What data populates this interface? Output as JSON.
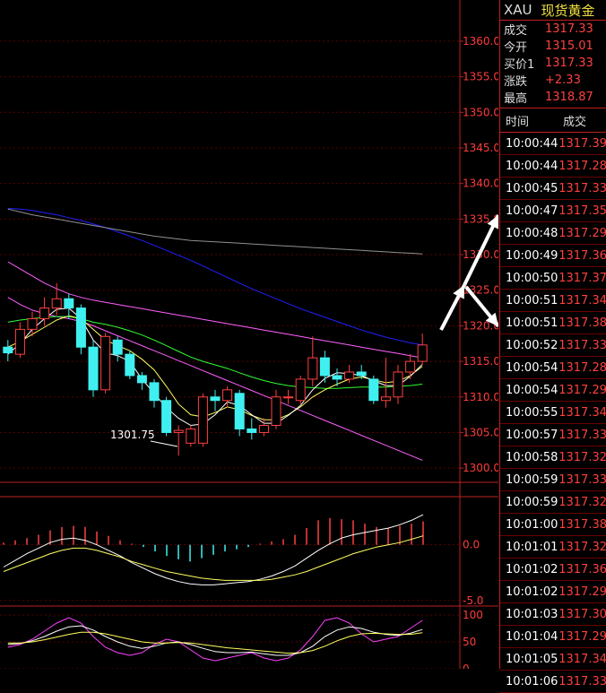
{
  "quote": {
    "symbol": "XAU",
    "name": "现货黄金",
    "rows": [
      {
        "label": "成交",
        "value": "1317.33"
      },
      {
        "label": "今开",
        "value": "1315.01"
      },
      {
        "label": "买价1",
        "value": "1317.33"
      },
      {
        "label": "涨跌",
        "value": "+2.33"
      },
      {
        "label": "最高",
        "value": "1318.87"
      }
    ]
  },
  "ticks": {
    "headers": {
      "time": "时间",
      "price": "成交"
    },
    "rows": [
      {
        "time": "10:00:44",
        "price": "1317.39"
      },
      {
        "time": "10:00:44",
        "price": "1317.28"
      },
      {
        "time": "10:00:45",
        "price": "1317.33"
      },
      {
        "time": "10:00:47",
        "price": "1317.35"
      },
      {
        "time": "10:00:48",
        "price": "1317.29"
      },
      {
        "time": "10:00:49",
        "price": "1317.36"
      },
      {
        "time": "10:00:50",
        "price": "1317.37"
      },
      {
        "time": "10:00:51",
        "price": "1317.34"
      },
      {
        "time": "10:00:51",
        "price": "1317.38"
      },
      {
        "time": "10:00:52",
        "price": "1317.33"
      },
      {
        "time": "10:00:54",
        "price": "1317.28"
      },
      {
        "time": "10:00:54",
        "price": "1317.29"
      },
      {
        "time": "10:00:55",
        "price": "1317.34"
      },
      {
        "time": "10:00:57",
        "price": "1317.33"
      },
      {
        "time": "10:00:58",
        "price": "1317.32"
      },
      {
        "time": "10:00:59",
        "price": "1317.33"
      },
      {
        "time": "10:00:59",
        "price": "1317.32"
      },
      {
        "time": "10:01:00",
        "price": "1317.38"
      },
      {
        "time": "10:01:01",
        "price": "1317.32"
      },
      {
        "time": "10:01:02",
        "price": "1317.36"
      },
      {
        "time": "10:01:02",
        "price": "1317.29"
      },
      {
        "time": "10:01:03",
        "price": "1317.30"
      },
      {
        "time": "10:01:04",
        "price": "1317.29"
      },
      {
        "time": "10:01:05",
        "price": "1317.34"
      },
      {
        "time": "10:01:06",
        "price": "1317.33"
      }
    ]
  },
  "chart_data": [
    {
      "type": "candlestick",
      "ylim": [
        1298,
        1361
      ],
      "y_ticks": [
        "1360.0",
        "1355.0",
        "1350.0",
        "1345.0",
        "1340.0",
        "1335.0",
        "1330.0",
        "1325.0",
        "1320.0",
        "1315.0",
        "1310.0",
        "1305.0",
        "1300.0"
      ],
      "y_tick_values": [
        1360,
        1355,
        1350,
        1345,
        1340,
        1335,
        1330,
        1325,
        1320,
        1315,
        1310,
        1305,
        1300
      ],
      "annotation": "1301.75",
      "candles": [
        {
          "o": 1317.0,
          "c": 1316.2,
          "h": 1318.0,
          "l": 1315.0
        },
        {
          "o": 1316.0,
          "c": 1319.5,
          "h": 1320.5,
          "l": 1315.5
        },
        {
          "o": 1319.5,
          "c": 1321.0,
          "h": 1322.0,
          "l": 1318.5
        },
        {
          "o": 1321.0,
          "c": 1322.5,
          "h": 1324.0,
          "l": 1320.0
        },
        {
          "o": 1322.5,
          "c": 1323.8,
          "h": 1326.0,
          "l": 1321.5
        },
        {
          "o": 1323.8,
          "c": 1322.5,
          "h": 1324.5,
          "l": 1321.0
        },
        {
          "o": 1322.5,
          "c": 1317.0,
          "h": 1323.0,
          "l": 1316.0
        },
        {
          "o": 1317.0,
          "c": 1311.0,
          "h": 1318.0,
          "l": 1310.0
        },
        {
          "o": 1311.0,
          "c": 1318.5,
          "h": 1319.0,
          "l": 1310.5
        },
        {
          "o": 1318.0,
          "c": 1316.0,
          "h": 1318.5,
          "l": 1315.0
        },
        {
          "o": 1316.0,
          "c": 1313.0,
          "h": 1316.5,
          "l": 1312.5
        },
        {
          "o": 1313.0,
          "c": 1312.0,
          "h": 1313.5,
          "l": 1311.0
        },
        {
          "o": 1312.0,
          "c": 1309.5,
          "h": 1312.5,
          "l": 1308.5
        },
        {
          "o": 1309.5,
          "c": 1305.0,
          "h": 1310.0,
          "l": 1304.5
        },
        {
          "o": 1305.0,
          "c": 1305.3,
          "h": 1306.0,
          "l": 1301.75
        },
        {
          "o": 1303.5,
          "c": 1305.5,
          "h": 1306.0,
          "l": 1303.0
        },
        {
          "o": 1303.5,
          "c": 1310.0,
          "h": 1310.5,
          "l": 1303.0
        },
        {
          "o": 1310.0,
          "c": 1309.5,
          "h": 1311.0,
          "l": 1308.0
        },
        {
          "o": 1309.5,
          "c": 1311.0,
          "h": 1311.5,
          "l": 1308.5
        },
        {
          "o": 1310.5,
          "c": 1305.5,
          "h": 1311.0,
          "l": 1304.5
        },
        {
          "o": 1305.5,
          "c": 1305.0,
          "h": 1307.0,
          "l": 1304.0
        },
        {
          "o": 1305.0,
          "c": 1306.0,
          "h": 1307.0,
          "l": 1304.5
        },
        {
          "o": 1306.0,
          "c": 1310.0,
          "h": 1311.0,
          "l": 1305.5
        },
        {
          "o": 1310.0,
          "c": 1310.0,
          "h": 1311.0,
          "l": 1309.0
        },
        {
          "o": 1309.5,
          "c": 1312.5,
          "h": 1313.0,
          "l": 1309.0
        },
        {
          "o": 1312.5,
          "c": 1315.5,
          "h": 1318.5,
          "l": 1311.5
        },
        {
          "o": 1315.5,
          "c": 1313.0,
          "h": 1316.5,
          "l": 1312.0
        },
        {
          "o": 1313.0,
          "c": 1312.5,
          "h": 1314.0,
          "l": 1311.5
        },
        {
          "o": 1312.5,
          "c": 1313.5,
          "h": 1314.5,
          "l": 1312.0
        },
        {
          "o": 1313.5,
          "c": 1313.0,
          "h": 1314.5,
          "l": 1312.5
        },
        {
          "o": 1312.5,
          "c": 1309.5,
          "h": 1313.0,
          "l": 1309.0
        },
        {
          "o": 1309.5,
          "c": 1310.0,
          "h": 1315.5,
          "l": 1308.5
        },
        {
          "o": 1310.0,
          "c": 1313.5,
          "h": 1314.5,
          "l": 1309.0
        },
        {
          "o": 1313.5,
          "c": 1315.0,
          "h": 1316.0,
          "l": 1312.5
        },
        {
          "o": 1315.0,
          "c": 1317.3,
          "h": 1318.9,
          "l": 1314.5
        }
      ],
      "lines": [
        {
          "color": "#2020ff",
          "values": [
            1336.5,
            1336.4,
            1336.2,
            1335.9,
            1335.6,
            1335.2,
            1334.8,
            1334.3,
            1333.8,
            1333.2,
            1332.6,
            1332.0,
            1331.3,
            1330.6,
            1329.9,
            1329.2,
            1328.4,
            1327.6,
            1326.8,
            1326.0,
            1325.2,
            1324.5,
            1323.8,
            1323.1,
            1322.4,
            1321.8,
            1321.2,
            1320.6,
            1320.0,
            1319.4,
            1318.9,
            1318.4,
            1318.0,
            1317.6,
            1317.3
          ]
        },
        {
          "color": "#909090",
          "values": [
            1336.4,
            1336.0,
            1335.6,
            1335.3,
            1335.0,
            1334.7,
            1334.4,
            1334.1,
            1333.8,
            1333.5,
            1333.2,
            1332.9,
            1332.6,
            1332.4,
            1332.2,
            1332.0,
            1331.9,
            1331.8,
            1331.7,
            1331.6,
            1331.5,
            1331.4,
            1331.3,
            1331.2,
            1331.1,
            1331.0,
            1330.9,
            1330.8,
            1330.7,
            1330.6,
            1330.5,
            1330.4,
            1330.3,
            1330.2,
            1330.1
          ]
        },
        {
          "color": "#ff60ff",
          "values": [
            1329.0,
            1328.0,
            1327.0,
            1326.0,
            1325.2,
            1324.5,
            1324.0,
            1323.6,
            1323.3,
            1323.0,
            1322.7,
            1322.4,
            1322.1,
            1321.8,
            1321.5,
            1321.2,
            1320.9,
            1320.6,
            1320.3,
            1320.0,
            1319.7,
            1319.4,
            1319.1,
            1318.8,
            1318.5,
            1318.2,
            1317.9,
            1317.6,
            1317.3,
            1317.0,
            1316.7,
            1316.4,
            1316.1,
            1315.8,
            1315.5
          ]
        },
        {
          "color": "#ff60ff",
          "values": [
            1324.0,
            1323.0,
            1322.2,
            1321.7,
            1321.3,
            1321.0,
            1320.6,
            1320.0,
            1319.3,
            1318.6,
            1317.9,
            1317.2,
            1316.5,
            1315.8,
            1315.1,
            1314.4,
            1313.7,
            1313.0,
            1312.3,
            1311.6,
            1310.9,
            1310.2,
            1309.5,
            1308.8,
            1308.1,
            1307.4,
            1306.7,
            1306.0,
            1305.3,
            1304.6,
            1303.9,
            1303.2,
            1302.5,
            1301.8,
            1301.1
          ]
        },
        {
          "color": "#30ff30",
          "values": [
            1320.5,
            1320.8,
            1321.0,
            1321.2,
            1321.3,
            1321.3,
            1321.0,
            1320.5,
            1320.2,
            1319.8,
            1319.3,
            1318.7,
            1318.0,
            1317.2,
            1316.4,
            1315.6,
            1315.0,
            1314.5,
            1314.0,
            1313.4,
            1312.8,
            1312.3,
            1311.9,
            1311.6,
            1311.4,
            1311.3,
            1311.2,
            1311.2,
            1311.3,
            1311.4,
            1311.4,
            1311.4,
            1311.5,
            1311.6,
            1311.8
          ]
        },
        {
          "color": "#ffff60",
          "values": [
            1317.0,
            1317.8,
            1318.8,
            1319.8,
            1320.8,
            1321.4,
            1321.0,
            1319.5,
            1318.0,
            1317.2,
            1316.5,
            1315.3,
            1313.8,
            1311.5,
            1309.0,
            1307.5,
            1307.2,
            1307.8,
            1308.6,
            1308.2,
            1307.4,
            1306.8,
            1306.8,
            1307.5,
            1308.6,
            1310.0,
            1311.0,
            1311.8,
            1312.5,
            1312.8,
            1312.4,
            1312.0,
            1312.2,
            1313.0,
            1314.3
          ]
        },
        {
          "color": "#ffffff",
          "values": [
            1316.0,
            1317.5,
            1319.5,
            1321.0,
            1322.3,
            1322.5,
            1321.0,
            1318.0,
            1316.2,
            1315.8,
            1315.0,
            1312.5,
            1310.5,
            1308.5,
            1307.0,
            1306.0,
            1306.2,
            1307.5,
            1309.3,
            1308.8,
            1307.5,
            1306.3,
            1306.3,
            1307.4,
            1308.8,
            1311.0,
            1312.6,
            1313.4,
            1313.3,
            1313.0,
            1312.3,
            1311.6,
            1311.6,
            1312.9,
            1314.6
          ]
        }
      ]
    },
    {
      "type": "bar",
      "ylim": [
        -5.5,
        4.0
      ],
      "y_ticks": [
        "0.0",
        "-5.0"
      ],
      "y_tick_values": [
        0,
        -5
      ],
      "values": [
        0.2,
        0.4,
        0.6,
        0.9,
        1.3,
        1.6,
        1.7,
        1.6,
        1.2,
        0.8,
        0.4,
        0.1,
        -0.2,
        -0.6,
        -1.0,
        -1.3,
        -1.5,
        -1.2,
        -0.9,
        -0.6,
        -0.4,
        -0.2,
        0.1,
        0.3,
        0.5,
        0.9,
        1.5,
        2.2,
        2.4,
        2.3,
        2.2,
        1.9,
        1.6,
        1.5,
        1.7,
        1.9,
        2.1
      ],
      "lines": [
        {
          "color": "#ffffff",
          "values": [
            -2.0,
            -1.4,
            -0.8,
            -0.3,
            0.2,
            0.5,
            0.6,
            0.4,
            0.0,
            -0.5,
            -1.0,
            -1.6,
            -2.1,
            -2.6,
            -3.0,
            -3.3,
            -3.5,
            -3.6,
            -3.6,
            -3.5,
            -3.4,
            -3.3,
            -3.1,
            -2.8,
            -2.4,
            -1.9,
            -1.2,
            -0.5,
            0.1,
            0.6,
            0.9,
            1.1,
            1.3,
            1.5,
            1.8,
            2.2,
            2.7
          ]
        },
        {
          "color": "#ffff60",
          "values": [
            -2.4,
            -2.0,
            -1.6,
            -1.2,
            -0.8,
            -0.5,
            -0.3,
            -0.3,
            -0.5,
            -0.8,
            -1.1,
            -1.5,
            -1.8,
            -2.1,
            -2.4,
            -2.6,
            -2.8,
            -3.0,
            -3.1,
            -3.2,
            -3.2,
            -3.2,
            -3.2,
            -3.1,
            -2.9,
            -2.7,
            -2.4,
            -2.0,
            -1.6,
            -1.2,
            -0.8,
            -0.5,
            -0.2,
            0.0,
            0.2,
            0.5,
            0.8
          ]
        }
      ]
    },
    {
      "type": "line",
      "ylim": [
        0,
        110
      ],
      "y_ticks": [
        "100",
        "50",
        "0"
      ],
      "y_tick_values": [
        100,
        50,
        0
      ],
      "lines": [
        {
          "color": "#ff40ff",
          "values": [
            40,
            45,
            55,
            70,
            85,
            95,
            85,
            60,
            40,
            30,
            25,
            30,
            45,
            55,
            50,
            35,
            20,
            15,
            20,
            25,
            30,
            20,
            15,
            20,
            35,
            60,
            90,
            95,
            85,
            65,
            50,
            55,
            60,
            75,
            90
          ]
        },
        {
          "color": "#ffffff",
          "values": [
            45,
            47,
            52,
            60,
            70,
            78,
            80,
            72,
            60,
            50,
            42,
            38,
            42,
            48,
            50,
            45,
            38,
            32,
            30,
            30,
            31,
            28,
            25,
            25,
            30,
            42,
            60,
            72,
            78,
            75,
            68,
            64,
            62,
            66,
            73
          ]
        },
        {
          "color": "#ffff60",
          "values": [
            48,
            48,
            50,
            54,
            59,
            64,
            68,
            68,
            65,
            60,
            55,
            50,
            48,
            48,
            49,
            48,
            45,
            42,
            39,
            37,
            35,
            33,
            31,
            29,
            30,
            34,
            42,
            52,
            60,
            65,
            66,
            65,
            64,
            64,
            67
          ]
        }
      ]
    }
  ]
}
